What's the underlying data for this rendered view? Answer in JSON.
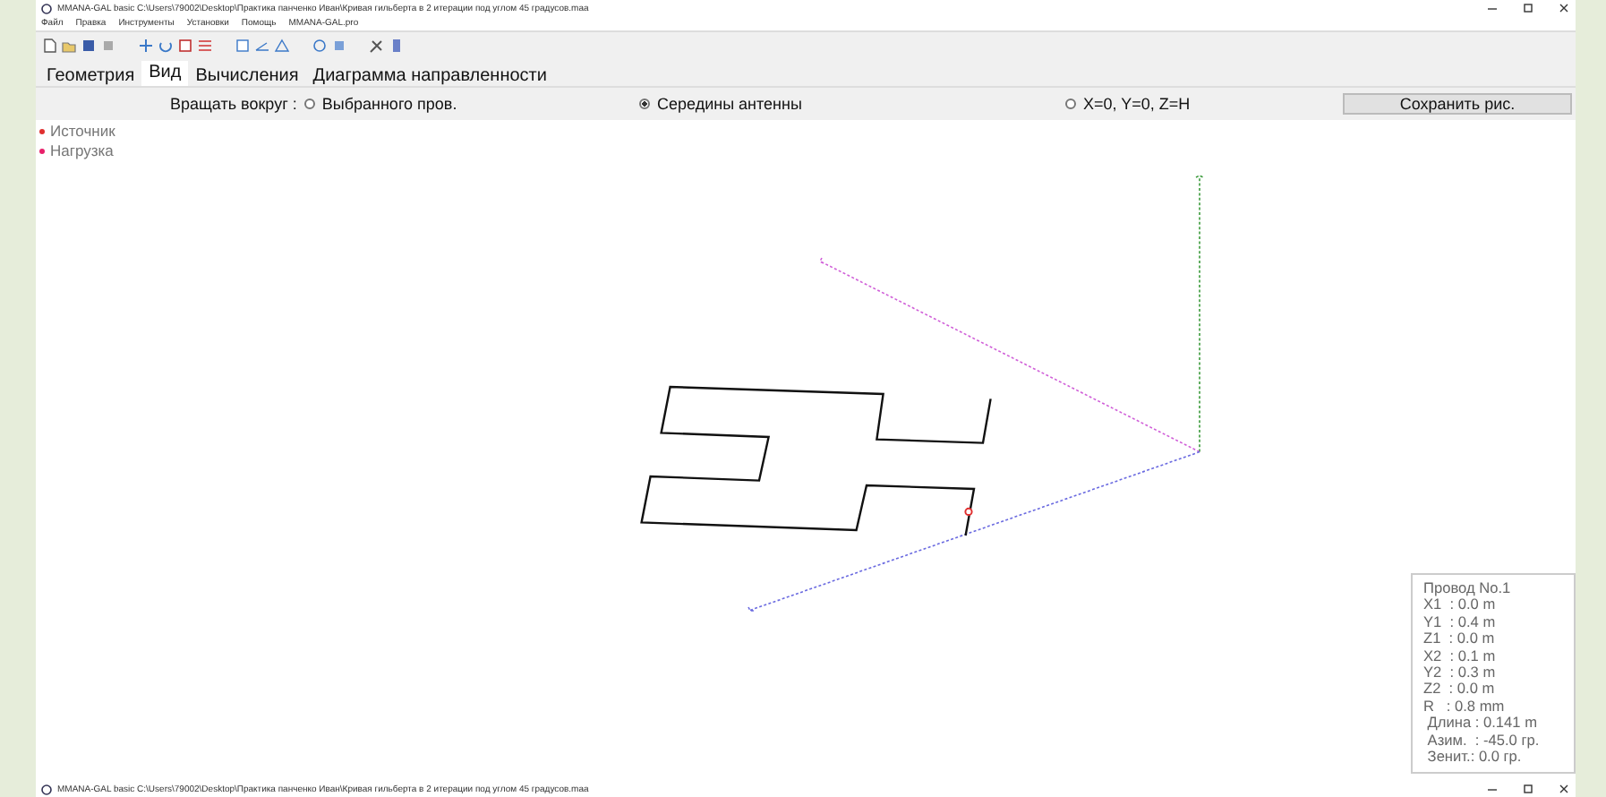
{
  "window": {
    "title": "MMANA-GAL basic C:\\Users\\79002\\Desktop\\Практика панченко Иван\\Кривая гильберта в 2 итерации под углом 45 градусов.maa"
  },
  "menu": [
    "Файл",
    "Правка",
    "Инструменты",
    "Установки",
    "Помощь",
    "MMANA-GAL.pro"
  ],
  "tabs": [
    {
      "label": "Геометрия",
      "selected": false
    },
    {
      "label": "Вид",
      "selected": true
    },
    {
      "label": "Вычисления",
      "selected": false
    },
    {
      "label": "Диаграмма направленности",
      "selected": false
    }
  ],
  "rotate": {
    "label": "Вращать вокруг :",
    "options": [
      {
        "label": "Выбранного пров.",
        "selected": false
      },
      {
        "label": "Середины антенны",
        "selected": true
      },
      {
        "label": "X=0, Y=0, Z=H",
        "selected": false
      }
    ]
  },
  "save_button": "Сохранить рис.",
  "legend": [
    {
      "label": "Источник",
      "color": "#e03030"
    },
    {
      "label": "Нагрузка",
      "color": "#e8206a"
    }
  ],
  "wire_info": [
    "Провод No.1",
    "X1  : 0.0 m",
    "Y1  : 0.4 m",
    "Z1  : 0.0 m",
    "X2  : 0.1 m",
    "Y2  : 0.3 m",
    "Z2  : 0.0 m",
    "R   : 0.8 mm",
    " Длина : 0.141 m",
    " Азим.  : -45.0 гр.",
    " Зенит.: 0.0 гр."
  ],
  "second_window": {
    "title": "MMANA-GAL basic C:\\Users\\79002\\Desktop\\Практика панченко Иван\\Кривая гильберта в 2 итерации под углом 45 градусов.maa"
  }
}
